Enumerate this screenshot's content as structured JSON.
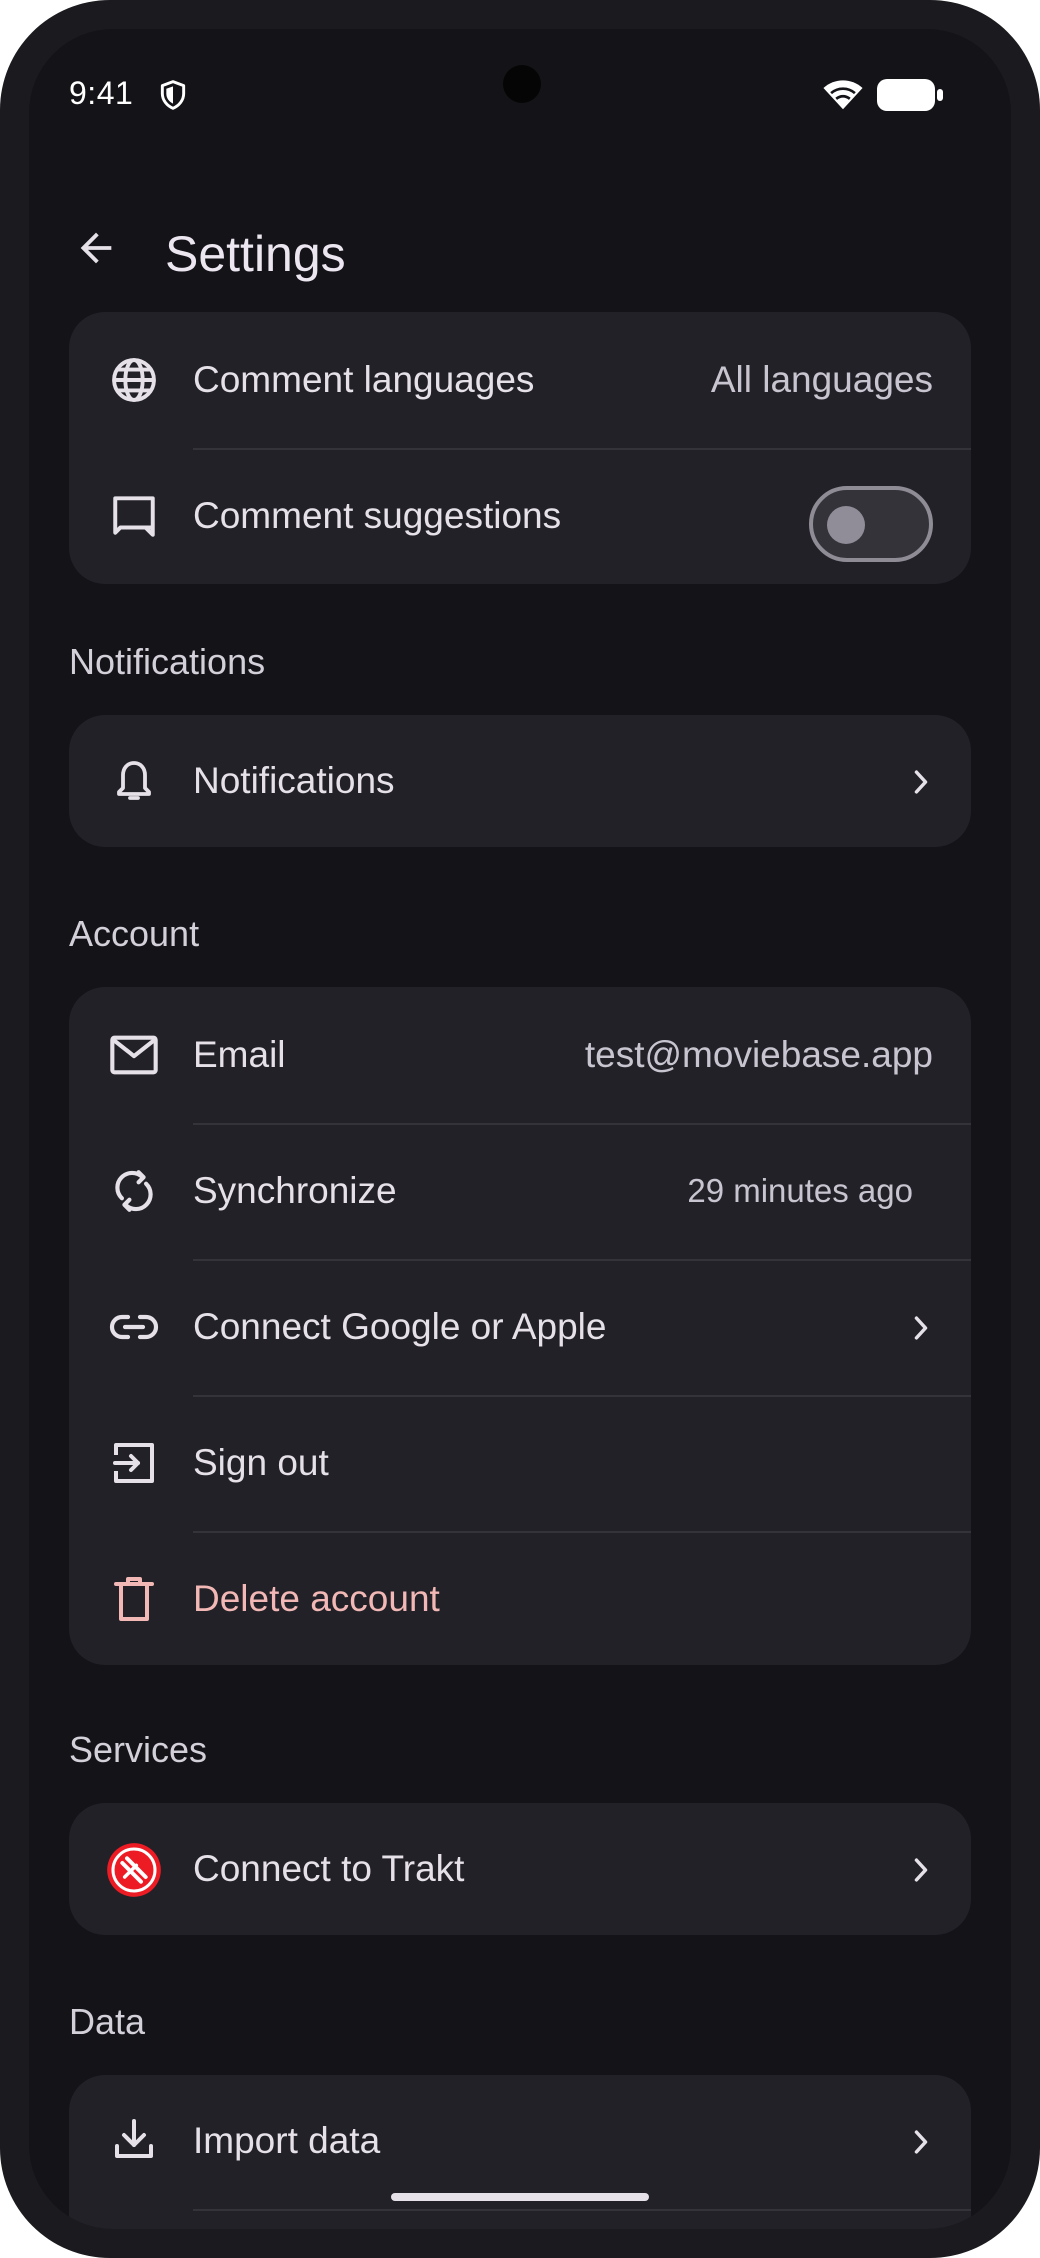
{
  "status_bar": {
    "time": "9:41"
  },
  "header": {
    "title": "Settings"
  },
  "comments": {
    "languages_label": "Comment languages",
    "languages_value": "All languages",
    "suggestions_label": "Comment suggestions",
    "suggestions_enabled": false
  },
  "notifications": {
    "section_title": "Notifications",
    "item_label": "Notifications"
  },
  "account": {
    "section_title": "Account",
    "email_label": "Email",
    "email_value": "test@moviebase.app",
    "sync_label": "Synchronize",
    "sync_value": "29 minutes ago",
    "connect_label": "Connect Google or Apple",
    "signout_label": "Sign out",
    "delete_label": "Delete account"
  },
  "services": {
    "section_title": "Services",
    "trakt_label": "Connect to Trakt"
  },
  "data": {
    "section_title": "Data",
    "import_label": "Import data"
  },
  "colors": {
    "background": "#141318",
    "card": "#222128",
    "danger": "#f2b8b5",
    "trakt_red": "#ed1c24"
  }
}
